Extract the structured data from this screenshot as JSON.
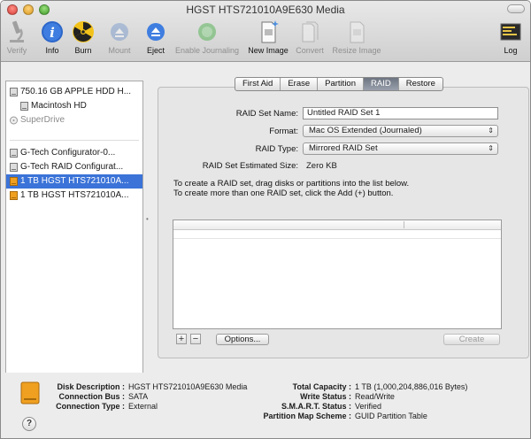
{
  "window": {
    "title": "HGST HTS721010A9E630 Media"
  },
  "toolbar": {
    "verify": "Verify",
    "info": "Info",
    "burn": "Burn",
    "mount": "Mount",
    "eject": "Eject",
    "enable_journaling": "Enable Journaling",
    "new_image": "New Image",
    "convert": "Convert",
    "resize_image": "Resize Image",
    "log": "Log"
  },
  "sidebar": {
    "items": [
      {
        "label": "750.16 GB APPLE HDD H..."
      },
      {
        "label": "Macintosh HD"
      },
      {
        "label": "SuperDrive"
      },
      {
        "label": "G-Tech Configurator-0..."
      },
      {
        "label": "G-Tech RAID Configurat..."
      },
      {
        "label": "1 TB HGST HTS721010A..."
      },
      {
        "label": "1 TB HGST HTS721010A..."
      }
    ]
  },
  "tabs": [
    "First Aid",
    "Erase",
    "Partition",
    "RAID",
    "Restore"
  ],
  "raid": {
    "set_name_label": "RAID Set Name:",
    "set_name_value": "Untitled RAID Set 1",
    "format_label": "Format:",
    "format_value": "Mac OS Extended (Journaled)",
    "type_label": "RAID Type:",
    "type_value": "Mirrored RAID Set",
    "size_label": "RAID Set Estimated Size:",
    "size_value": "Zero KB",
    "instr1": "To create a RAID set, drag disks or partitions into the list below.",
    "instr2": "To create more than one RAID set, click the Add (+) button.",
    "add": "+",
    "remove": "−",
    "options": "Options...",
    "create": "Create"
  },
  "info": {
    "disk_description_label": "Disk Description :",
    "disk_description_value": "HGST HTS721010A9E630 Media",
    "connection_bus_label": "Connection Bus :",
    "connection_bus_value": "SATA",
    "connection_type_label": "Connection Type :",
    "connection_type_value": "External",
    "total_capacity_label": "Total Capacity :",
    "total_capacity_value": "1 TB (1,000,204,886,016 Bytes)",
    "write_status_label": "Write Status :",
    "write_status_value": "Read/Write",
    "smart_label": "S.M.A.R.T. Status :",
    "smart_value": "Verified",
    "partition_label": "Partition Map Scheme :",
    "partition_value": "GUID Partition Table"
  },
  "help": "?",
  "colors": {
    "selection": "#3b73d8",
    "disk_orange": "#f0a020"
  }
}
